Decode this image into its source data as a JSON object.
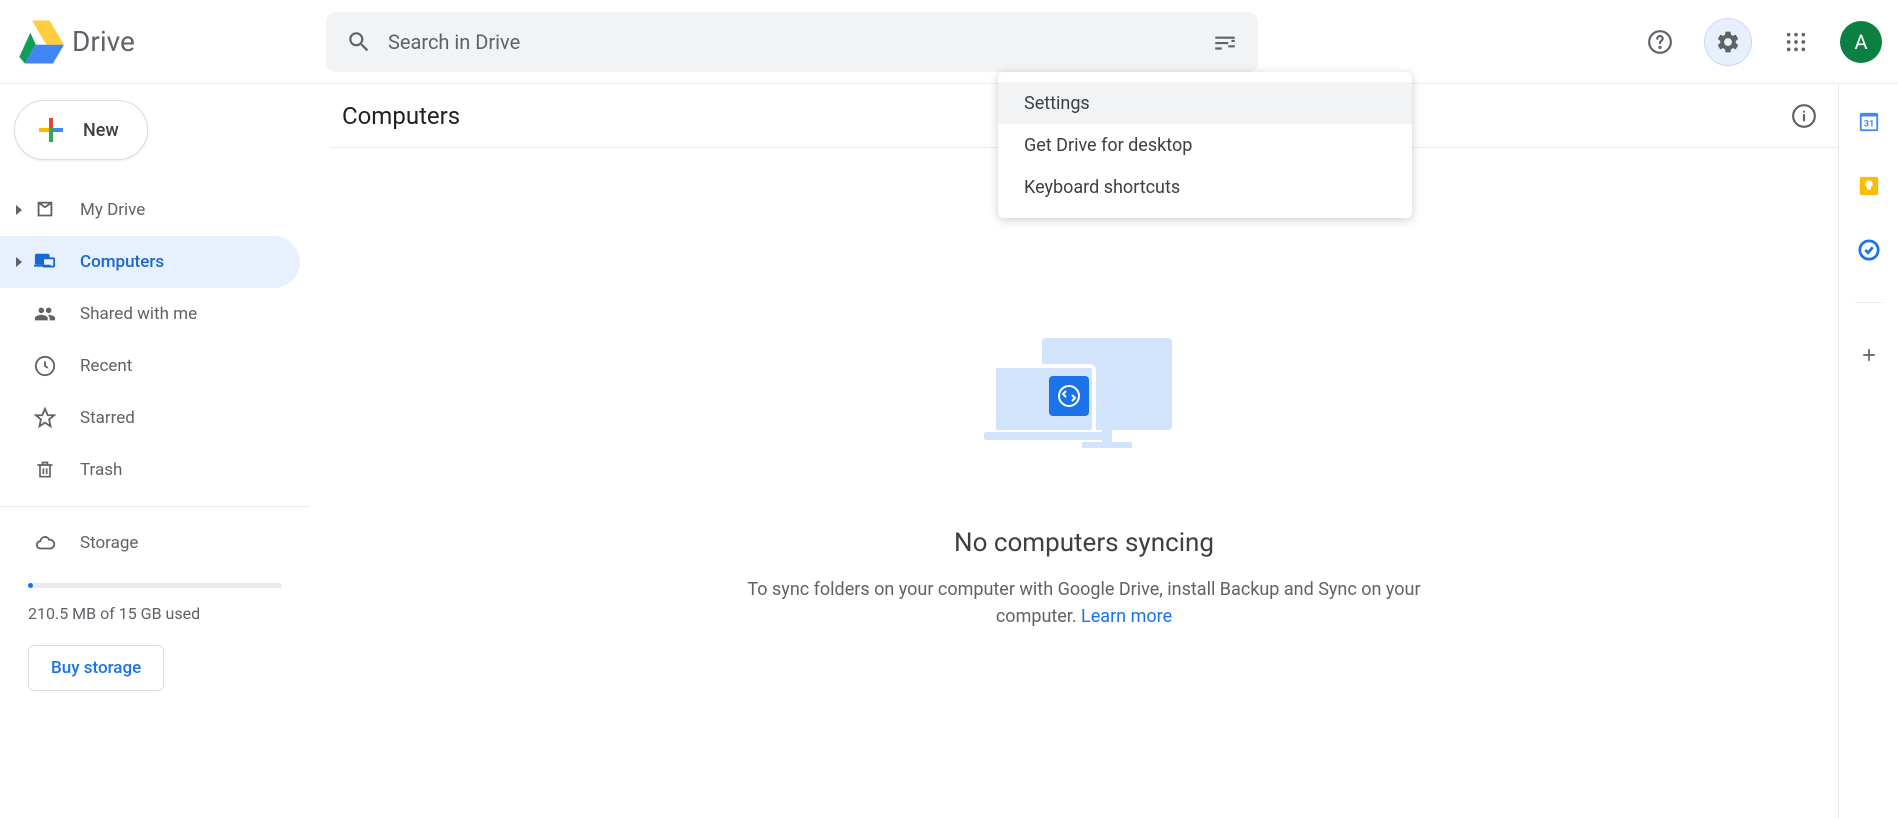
{
  "header": {
    "app_name": "Drive",
    "search_placeholder": "Search in Drive",
    "avatar_initial": "A"
  },
  "sidebar": {
    "new_label": "New",
    "items": [
      {
        "label": "My Drive"
      },
      {
        "label": "Computers"
      },
      {
        "label": "Shared with me"
      },
      {
        "label": "Recent"
      },
      {
        "label": "Starred"
      },
      {
        "label": "Trash"
      }
    ],
    "storage_label": "Storage",
    "storage_used_text": "210.5 MB of 15 GB used",
    "buy_label": "Buy storage"
  },
  "main": {
    "title": "Computers",
    "empty_heading": "No computers syncing",
    "empty_body_1": "To sync folders on your computer with Google Drive, install Backup and Sync on your computer. ",
    "empty_link": "Learn more"
  },
  "settings_menu": {
    "items": [
      "Settings",
      "Get Drive for desktop",
      "Keyboard shortcuts"
    ]
  }
}
